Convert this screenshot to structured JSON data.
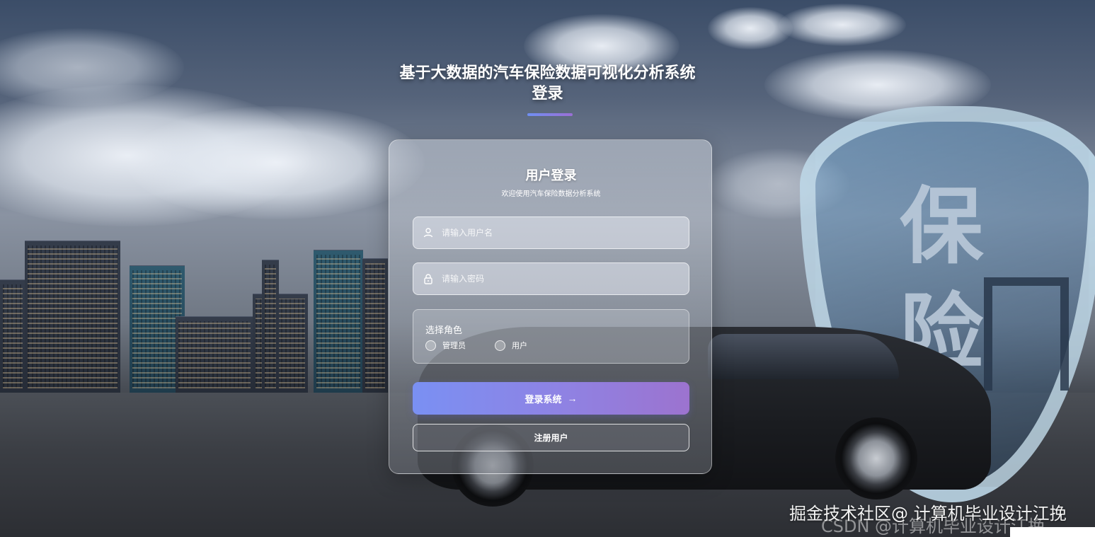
{
  "page": {
    "title_line1": "基于大数据的汽车保险数据可视化分析系统",
    "title_line2": "登录"
  },
  "card": {
    "title": "用户登录",
    "subtitle": "欢迎使用汽车保险数据分析系统"
  },
  "form": {
    "username_placeholder": "请输入用户名",
    "password_placeholder": "请输入密码",
    "role_label": "选择角色",
    "roles": [
      {
        "label": "管理员",
        "selected": false
      },
      {
        "label": "用户",
        "selected": false
      }
    ],
    "login_button": "登录系统",
    "login_arrow": "→",
    "register_button": "注册用户"
  },
  "background": {
    "shield_text_1": "保",
    "shield_text_2": "险"
  },
  "watermark": {
    "line1": "掘金技术社区@ 计算机毕业设计江挽",
    "line2": "CSDN @计算机毕业设计江挽"
  },
  "colors": {
    "accent_start": "#7a90f3",
    "accent_end": "#9c73cf"
  },
  "icons": {
    "username": "user-icon",
    "password": "lock-icon",
    "login_arrow": "arrow-right-icon"
  }
}
